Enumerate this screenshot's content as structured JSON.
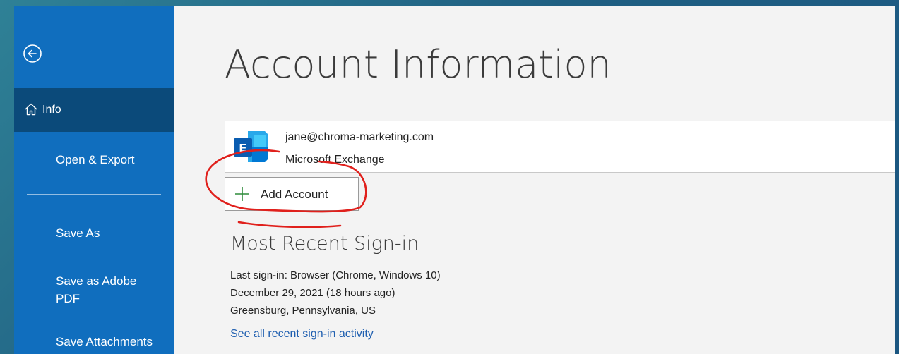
{
  "sidebar": {
    "items": [
      {
        "label": "Info",
        "icon": "home-icon",
        "selected": true
      },
      {
        "label": "Open & Export"
      },
      {
        "label": "Save As"
      },
      {
        "label": "Save as Adobe PDF"
      },
      {
        "label": "Save Attachments"
      }
    ],
    "back_icon": "back-arrow-icon"
  },
  "main": {
    "title": "Account Information",
    "account": {
      "email": "jane@chroma-marketing.com",
      "type": "Microsoft Exchange",
      "icon": "exchange-icon"
    },
    "add_account_label": "Add Account",
    "sign_in": {
      "title": "Most Recent Sign-in",
      "lines": [
        "Last sign-in: Browser (Chrome, Windows 10)",
        "December 29, 2021 (18 hours ago)",
        "Greensburg, Pennsylvania, US"
      ],
      "link": "See all recent sign-in activity"
    }
  },
  "colors": {
    "sidebar": "#106ebe",
    "sidebar_selected": "#0b4a7a",
    "annotation": "#e0201c",
    "link": "#1f5fb0"
  }
}
